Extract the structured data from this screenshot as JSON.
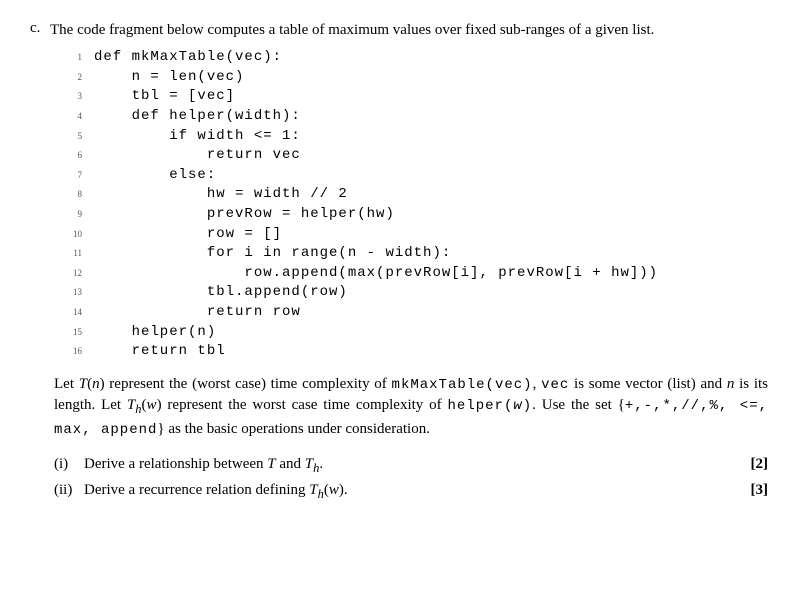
{
  "question": {
    "label": "c.",
    "intro": "The code fragment below computes a table of maximum values over fixed sub-ranges of a given list."
  },
  "code": {
    "lines": [
      {
        "n": "1",
        "t": "def mkMaxTable(vec):"
      },
      {
        "n": "2",
        "t": "    n = len(vec)"
      },
      {
        "n": "3",
        "t": "    tbl = [vec]"
      },
      {
        "n": "4",
        "t": "    def helper(width):"
      },
      {
        "n": "5",
        "t": "        if width <= 1:"
      },
      {
        "n": "6",
        "t": "            return vec"
      },
      {
        "n": "7",
        "t": "        else:"
      },
      {
        "n": "8",
        "t": "            hw = width // 2"
      },
      {
        "n": "9",
        "t": "            prevRow = helper(hw)"
      },
      {
        "n": "10",
        "t": "            row = []"
      },
      {
        "n": "11",
        "t": "            for i in range(n - width):"
      },
      {
        "n": "12",
        "t": "                row.append(max(prevRow[i], prevRow[i + hw]))"
      },
      {
        "n": "13",
        "t": "            tbl.append(row)"
      },
      {
        "n": "14",
        "t": "            return row"
      },
      {
        "n": "15",
        "t": "    helper(n)"
      },
      {
        "n": "16",
        "t": "    return tbl"
      }
    ]
  },
  "post": {
    "p1a": "Let ",
    "Tn": "T",
    "p1b": "(",
    "n1": "n",
    "p1c": ") represent the (worst case) time complexity of ",
    "fn1": "mkMaxTable(vec)",
    "p1d": ", ",
    "vec": "vec",
    "p1e": " is some vector (list) and ",
    "n2": "n",
    "p1f": " is its length. Let ",
    "Th": "T",
    "hsub": "h",
    "p1g": "(",
    "w1": "w",
    "p1h": ") represent the worst case time complexity of ",
    "fn2": "helper(",
    "w2": "w",
    "fn2b": ")",
    "p1i": ". Use the set {",
    "ops": "+,-,*,//,%, <=, max, append",
    "p1j": "} as the basic operations under consideration."
  },
  "subparts": {
    "i": {
      "label": "(i)",
      "text_a": "Derive a relationship between ",
      "T": "T",
      "text_b": " and ",
      "Th": "T",
      "hsub": "h",
      "text_c": ".",
      "marks": "[2]"
    },
    "ii": {
      "label": "(ii)",
      "text_a": "Derive a recurrence relation defining ",
      "Th": "T",
      "hsub": "h",
      "text_b": "(",
      "w": "w",
      "text_c": ").",
      "marks": "[3]"
    }
  }
}
